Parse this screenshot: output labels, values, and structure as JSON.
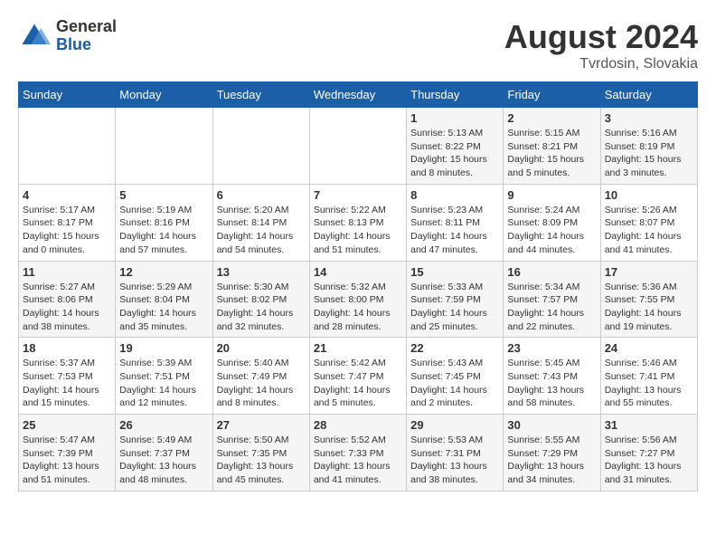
{
  "header": {
    "logo_general": "General",
    "logo_blue": "Blue",
    "month_year": "August 2024",
    "location": "Tvrdosin, Slovakia"
  },
  "weekdays": [
    "Sunday",
    "Monday",
    "Tuesday",
    "Wednesday",
    "Thursday",
    "Friday",
    "Saturday"
  ],
  "weeks": [
    [
      {
        "day": "",
        "info": ""
      },
      {
        "day": "",
        "info": ""
      },
      {
        "day": "",
        "info": ""
      },
      {
        "day": "",
        "info": ""
      },
      {
        "day": "1",
        "info": "Sunrise: 5:13 AM\nSunset: 8:22 PM\nDaylight: 15 hours\nand 8 minutes."
      },
      {
        "day": "2",
        "info": "Sunrise: 5:15 AM\nSunset: 8:21 PM\nDaylight: 15 hours\nand 5 minutes."
      },
      {
        "day": "3",
        "info": "Sunrise: 5:16 AM\nSunset: 8:19 PM\nDaylight: 15 hours\nand 3 minutes."
      }
    ],
    [
      {
        "day": "4",
        "info": "Sunrise: 5:17 AM\nSunset: 8:17 PM\nDaylight: 15 hours\nand 0 minutes."
      },
      {
        "day": "5",
        "info": "Sunrise: 5:19 AM\nSunset: 8:16 PM\nDaylight: 14 hours\nand 57 minutes."
      },
      {
        "day": "6",
        "info": "Sunrise: 5:20 AM\nSunset: 8:14 PM\nDaylight: 14 hours\nand 54 minutes."
      },
      {
        "day": "7",
        "info": "Sunrise: 5:22 AM\nSunset: 8:13 PM\nDaylight: 14 hours\nand 51 minutes."
      },
      {
        "day": "8",
        "info": "Sunrise: 5:23 AM\nSunset: 8:11 PM\nDaylight: 14 hours\nand 47 minutes."
      },
      {
        "day": "9",
        "info": "Sunrise: 5:24 AM\nSunset: 8:09 PM\nDaylight: 14 hours\nand 44 minutes."
      },
      {
        "day": "10",
        "info": "Sunrise: 5:26 AM\nSunset: 8:07 PM\nDaylight: 14 hours\nand 41 minutes."
      }
    ],
    [
      {
        "day": "11",
        "info": "Sunrise: 5:27 AM\nSunset: 8:06 PM\nDaylight: 14 hours\nand 38 minutes."
      },
      {
        "day": "12",
        "info": "Sunrise: 5:29 AM\nSunset: 8:04 PM\nDaylight: 14 hours\nand 35 minutes."
      },
      {
        "day": "13",
        "info": "Sunrise: 5:30 AM\nSunset: 8:02 PM\nDaylight: 14 hours\nand 32 minutes."
      },
      {
        "day": "14",
        "info": "Sunrise: 5:32 AM\nSunset: 8:00 PM\nDaylight: 14 hours\nand 28 minutes."
      },
      {
        "day": "15",
        "info": "Sunrise: 5:33 AM\nSunset: 7:59 PM\nDaylight: 14 hours\nand 25 minutes."
      },
      {
        "day": "16",
        "info": "Sunrise: 5:34 AM\nSunset: 7:57 PM\nDaylight: 14 hours\nand 22 minutes."
      },
      {
        "day": "17",
        "info": "Sunrise: 5:36 AM\nSunset: 7:55 PM\nDaylight: 14 hours\nand 19 minutes."
      }
    ],
    [
      {
        "day": "18",
        "info": "Sunrise: 5:37 AM\nSunset: 7:53 PM\nDaylight: 14 hours\nand 15 minutes."
      },
      {
        "day": "19",
        "info": "Sunrise: 5:39 AM\nSunset: 7:51 PM\nDaylight: 14 hours\nand 12 minutes."
      },
      {
        "day": "20",
        "info": "Sunrise: 5:40 AM\nSunset: 7:49 PM\nDaylight: 14 hours\nand 8 minutes."
      },
      {
        "day": "21",
        "info": "Sunrise: 5:42 AM\nSunset: 7:47 PM\nDaylight: 14 hours\nand 5 minutes."
      },
      {
        "day": "22",
        "info": "Sunrise: 5:43 AM\nSunset: 7:45 PM\nDaylight: 14 hours\nand 2 minutes."
      },
      {
        "day": "23",
        "info": "Sunrise: 5:45 AM\nSunset: 7:43 PM\nDaylight: 13 hours\nand 58 minutes."
      },
      {
        "day": "24",
        "info": "Sunrise: 5:46 AM\nSunset: 7:41 PM\nDaylight: 13 hours\nand 55 minutes."
      }
    ],
    [
      {
        "day": "25",
        "info": "Sunrise: 5:47 AM\nSunset: 7:39 PM\nDaylight: 13 hours\nand 51 minutes."
      },
      {
        "day": "26",
        "info": "Sunrise: 5:49 AM\nSunset: 7:37 PM\nDaylight: 13 hours\nand 48 minutes."
      },
      {
        "day": "27",
        "info": "Sunrise: 5:50 AM\nSunset: 7:35 PM\nDaylight: 13 hours\nand 45 minutes."
      },
      {
        "day": "28",
        "info": "Sunrise: 5:52 AM\nSunset: 7:33 PM\nDaylight: 13 hours\nand 41 minutes."
      },
      {
        "day": "29",
        "info": "Sunrise: 5:53 AM\nSunset: 7:31 PM\nDaylight: 13 hours\nand 38 minutes."
      },
      {
        "day": "30",
        "info": "Sunrise: 5:55 AM\nSunset: 7:29 PM\nDaylight: 13 hours\nand 34 minutes."
      },
      {
        "day": "31",
        "info": "Sunrise: 5:56 AM\nSunset: 7:27 PM\nDaylight: 13 hours\nand 31 minutes."
      }
    ]
  ]
}
